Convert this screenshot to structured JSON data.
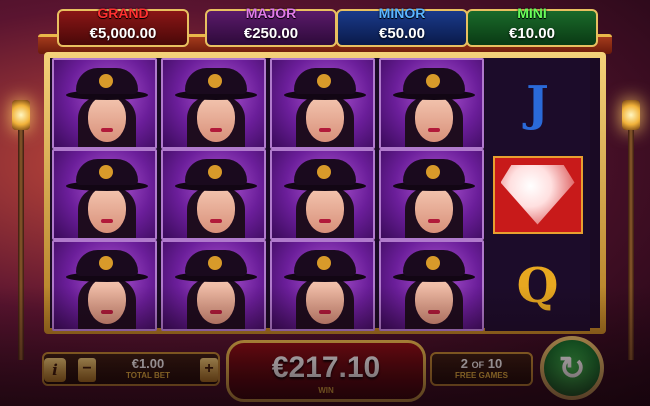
{
  "jackpots": {
    "grand": {
      "title": "GRAND",
      "value": "€5,000.00"
    },
    "major": {
      "title": "MAJOR",
      "value": "€250.00"
    },
    "minor": {
      "title": "MINOR",
      "value": "€50.00"
    },
    "mini": {
      "title": "MINI",
      "value": "€10.00"
    }
  },
  "reels": {
    "columns": 5,
    "rows": 3,
    "grid": [
      [
        "lady-in-top-hat",
        "lady-in-top-hat",
        "lady-in-top-hat",
        "lady-in-top-hat",
        "J"
      ],
      [
        "lady-in-top-hat",
        "lady-in-top-hat",
        "lady-in-top-hat",
        "lady-in-top-hat",
        "diamond"
      ],
      [
        "lady-in-top-hat",
        "lady-in-top-hat",
        "lady-in-top-hat",
        "lady-in-top-hat",
        "Q"
      ]
    ],
    "reel5": {
      "top_letter": "J",
      "bottom_letter": "Q"
    }
  },
  "controls": {
    "info_label": "i",
    "minus_label": "−",
    "plus_label": "+",
    "bet_value": "€1.00",
    "bet_label": "TOTAL BET",
    "win_value": "€217.10",
    "win_label": "WIN",
    "free_games_current": "2",
    "free_games_of": "OF",
    "free_games_total": "10",
    "free_games_label": "FREE GAMES",
    "spin_icon": "refresh-arrows-icon"
  },
  "colors": {
    "grand": "#ff3030",
    "major": "#e07ae8",
    "minor": "#5ab4ff",
    "mini": "#6aff5a",
    "gold": "#f4c040"
  }
}
